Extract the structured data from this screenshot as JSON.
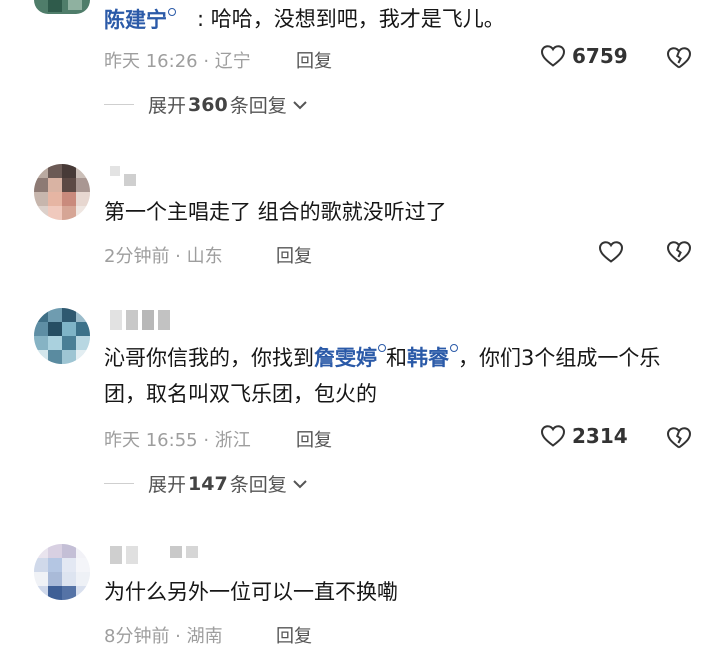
{
  "comments": [
    {
      "user": "陈建宁",
      "text": "哈哈，没想到吧，我才是飞儿。",
      "time": "昨天 16:26",
      "region": "辽宁",
      "reply": "回复",
      "likes": "6759",
      "expand": {
        "prefix": "展开",
        "count": "360",
        "suffix": "条回复"
      }
    },
    {
      "text": "第一个主唱走了 组合的歌就没听过了",
      "time": "2分钟前",
      "region": "山东",
      "reply": "回复"
    },
    {
      "text_parts": [
        "沁哥你信我的，你找到",
        "詹雯婷",
        "和",
        "韩睿",
        "，你们3个组成一个乐团，取名叫双飞乐团，包火的"
      ],
      "time": "昨天 16:55",
      "region": "浙江",
      "reply": "回复",
      "likes": "2314",
      "expand": {
        "prefix": "展开",
        "count": "147",
        "suffix": "条回复"
      }
    },
    {
      "text": "为什么另外一位可以一直不换嘞",
      "time": "8分钟前",
      "region": "湖南",
      "reply": "回复"
    }
  ],
  "separator": " · ",
  "colors": {
    "mention": "#2b5aa8",
    "meta": "#9e9e9e",
    "text": "#161616"
  },
  "icons": {
    "like": "heart-outline-icon",
    "dislike": "broken-heart-icon",
    "expand": "chevron-down-icon",
    "mention": "search-mention-icon"
  }
}
